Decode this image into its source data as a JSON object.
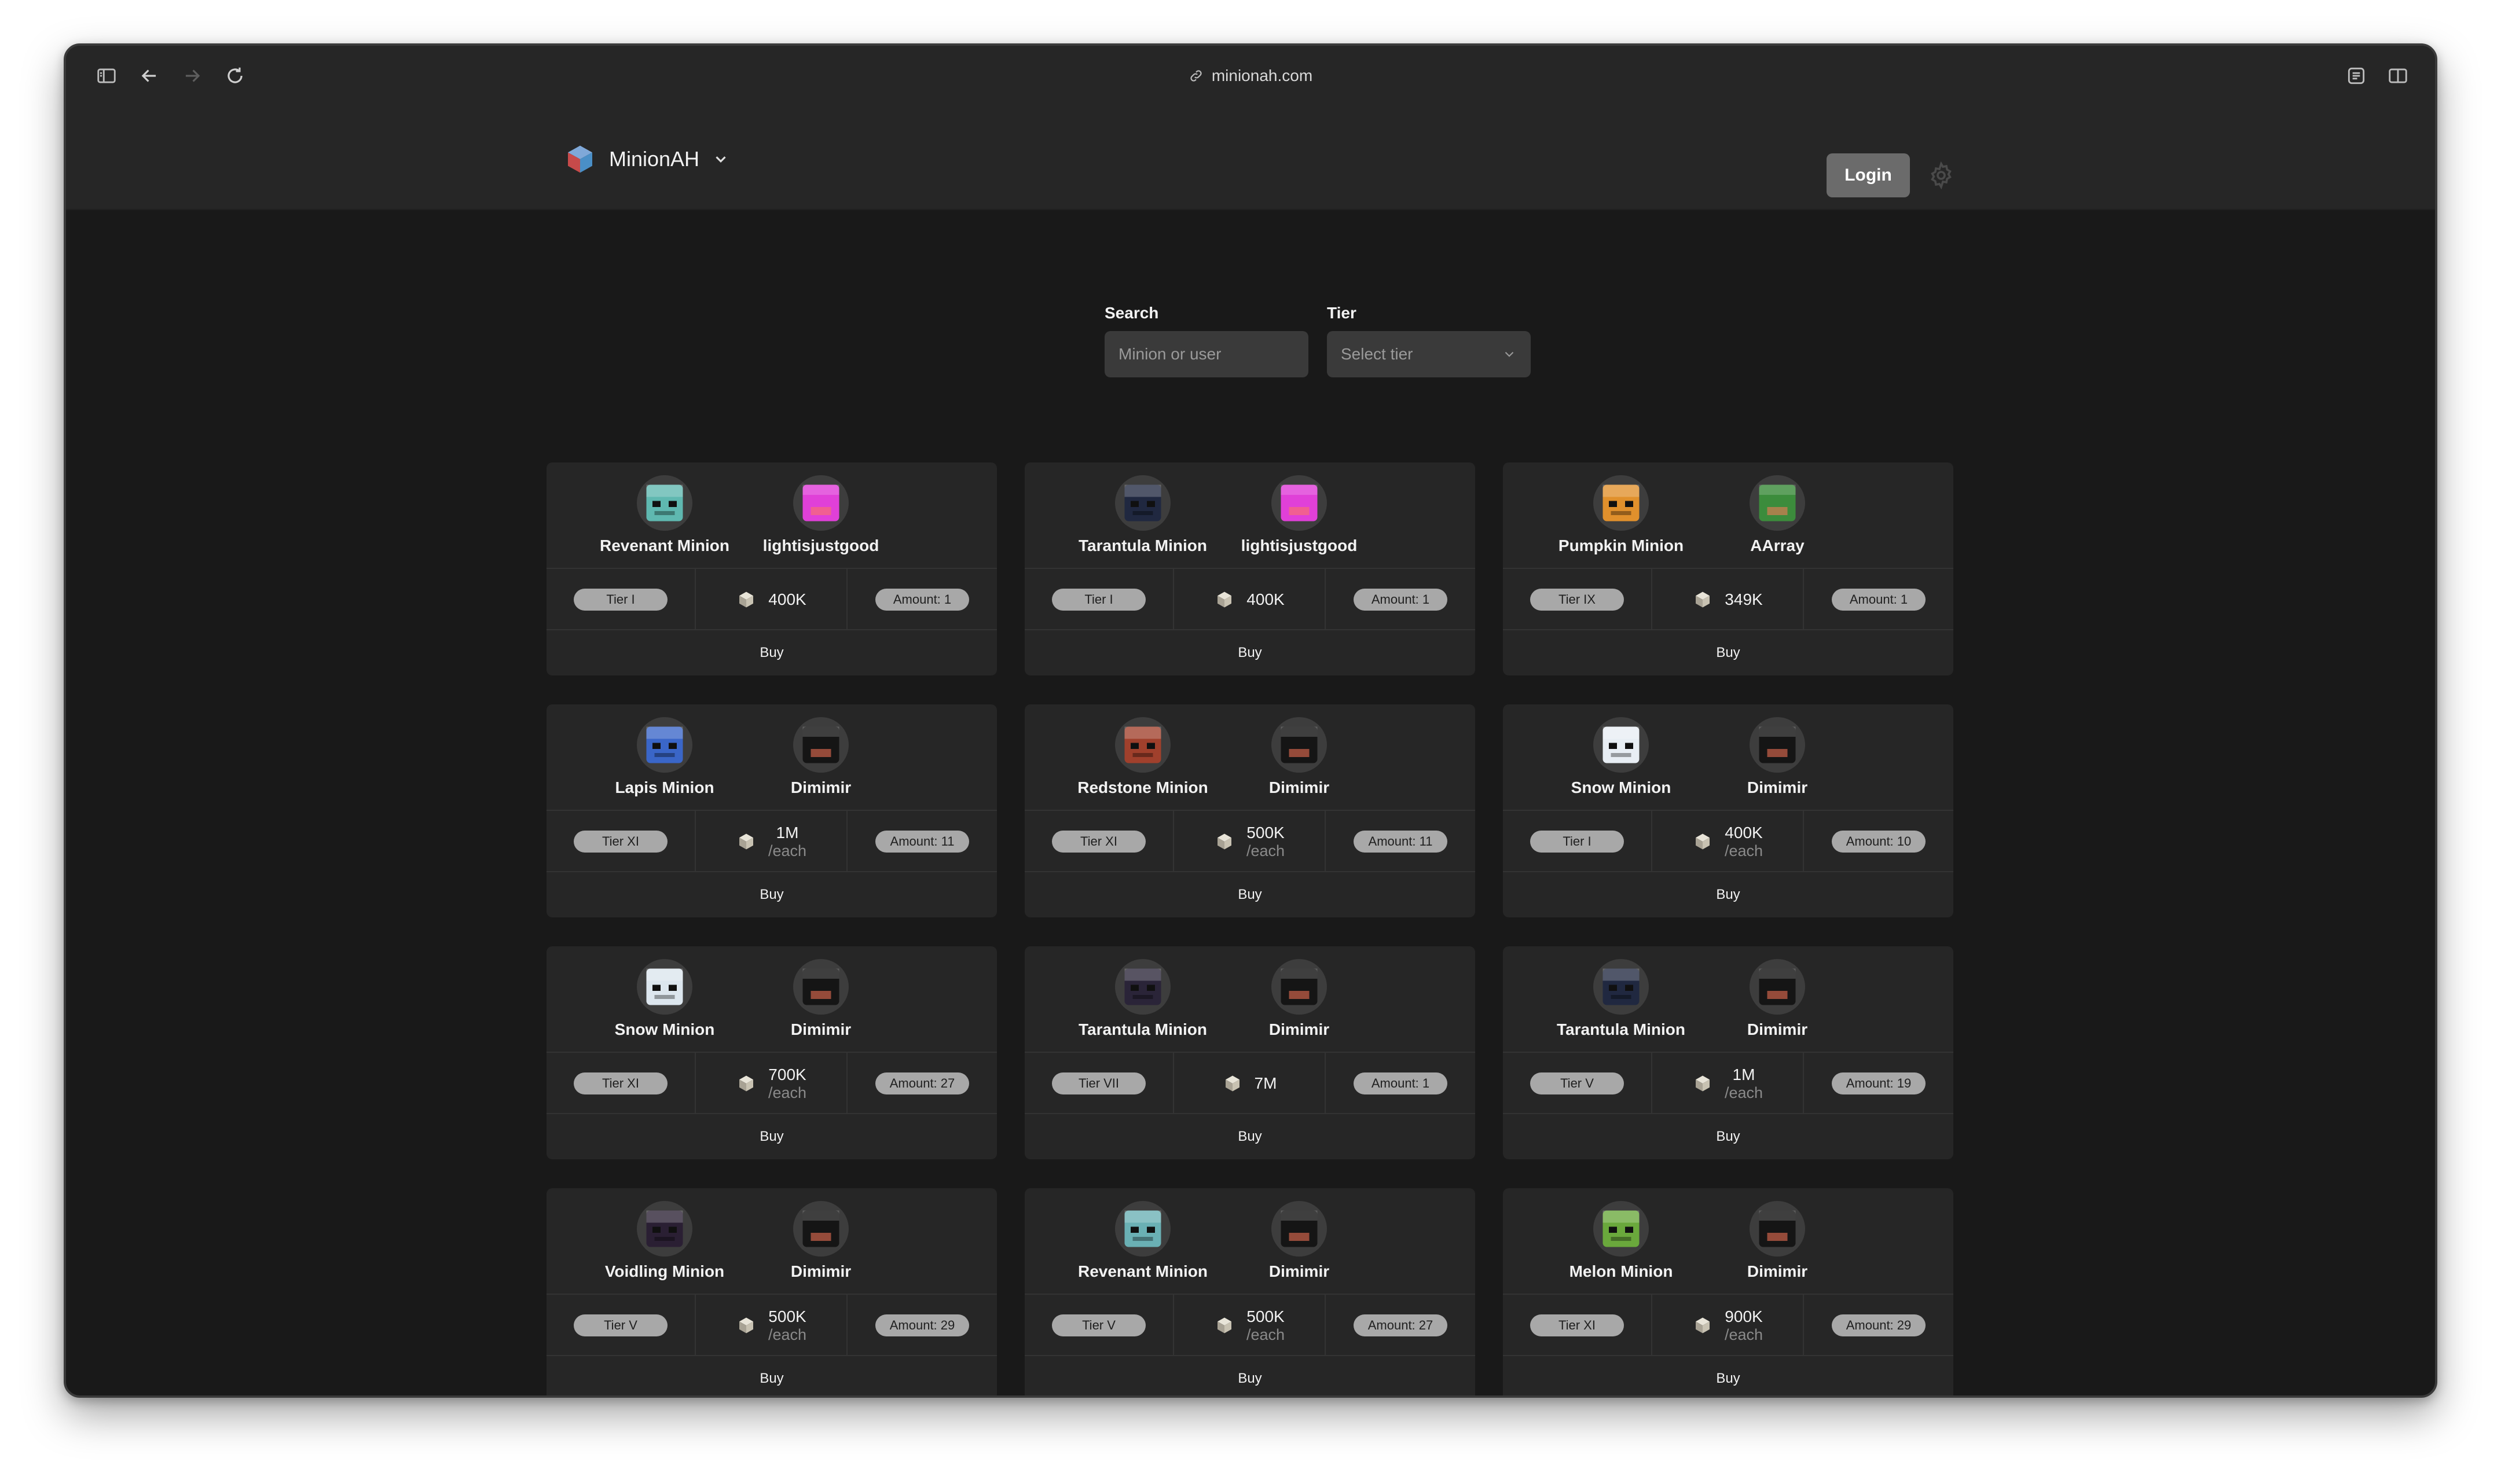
{
  "browser": {
    "url": "minionah.com"
  },
  "site": {
    "brand": "MinionAH",
    "login_label": "Login"
  },
  "filters": {
    "search_label": "Search",
    "search_placeholder": "Minion or user",
    "tier_label": "Tier",
    "tier_placeholder": "Select tier"
  },
  "buy_label": "Buy",
  "listings": [
    {
      "minion": "Revenant Minion",
      "seller": "lightisjustgood",
      "tier": "Tier I",
      "price": "400K",
      "each": "",
      "amount": "Amount: 1",
      "minion_color": "#5fb8b0",
      "seller_color": "#e040d8"
    },
    {
      "minion": "Tarantula Minion",
      "seller": "lightisjustgood",
      "tier": "Tier I",
      "price": "400K",
      "each": "",
      "amount": "Amount: 1",
      "minion_color": "#202840",
      "seller_color": "#e040d8"
    },
    {
      "minion": "Pumpkin Minion",
      "seller": "AArray",
      "tier": "Tier IX",
      "price": "349K",
      "each": "",
      "amount": "Amount: 1",
      "minion_color": "#e0902c",
      "seller_color": "#3c8c3c"
    },
    {
      "minion": "Lapis Minion",
      "seller": "Dimimir",
      "tier": "Tier XI",
      "price": "1M",
      "each": "/each",
      "amount": "Amount: 11",
      "minion_color": "#3a66c8",
      "seller_color": "#151515"
    },
    {
      "minion": "Redstone Minion",
      "seller": "Dimimir",
      "tier": "Tier XI",
      "price": "500K",
      "each": "/each",
      "amount": "Amount: 11",
      "minion_color": "#a0402c",
      "seller_color": "#151515"
    },
    {
      "minion": "Snow Minion",
      "seller": "Dimimir",
      "tier": "Tier I",
      "price": "400K",
      "each": "/each",
      "amount": "Amount: 10",
      "minion_color": "#e8eef4",
      "seller_color": "#151515"
    },
    {
      "minion": "Snow Minion",
      "seller": "Dimimir",
      "tier": "Tier XI",
      "price": "700K",
      "each": "/each",
      "amount": "Amount: 27",
      "minion_color": "#dce6ee",
      "seller_color": "#151515"
    },
    {
      "minion": "Tarantula Minion",
      "seller": "Dimimir",
      "tier": "Tier VII",
      "price": "7M",
      "each": "",
      "amount": "Amount: 1",
      "minion_color": "#2a2438",
      "seller_color": "#151515"
    },
    {
      "minion": "Tarantula Minion",
      "seller": "Dimimir",
      "tier": "Tier V",
      "price": "1M",
      "each": "/each",
      "amount": "Amount: 19",
      "minion_color": "#202840",
      "seller_color": "#151515"
    },
    {
      "minion": "Voidling Minion",
      "seller": "Dimimir",
      "tier": "Tier V",
      "price": "500K",
      "each": "/each",
      "amount": "Amount: 29",
      "minion_color": "#2a1f33",
      "seller_color": "#151515"
    },
    {
      "minion": "Revenant Minion",
      "seller": "Dimimir",
      "tier": "Tier V",
      "price": "500K",
      "each": "/each",
      "amount": "Amount: 27",
      "minion_color": "#6ab0b4",
      "seller_color": "#151515"
    },
    {
      "minion": "Melon Minion",
      "seller": "Dimimir",
      "tier": "Tier XI",
      "price": "900K",
      "each": "/each",
      "amount": "Amount: 29",
      "minion_color": "#6aa83c",
      "seller_color": "#151515"
    }
  ]
}
